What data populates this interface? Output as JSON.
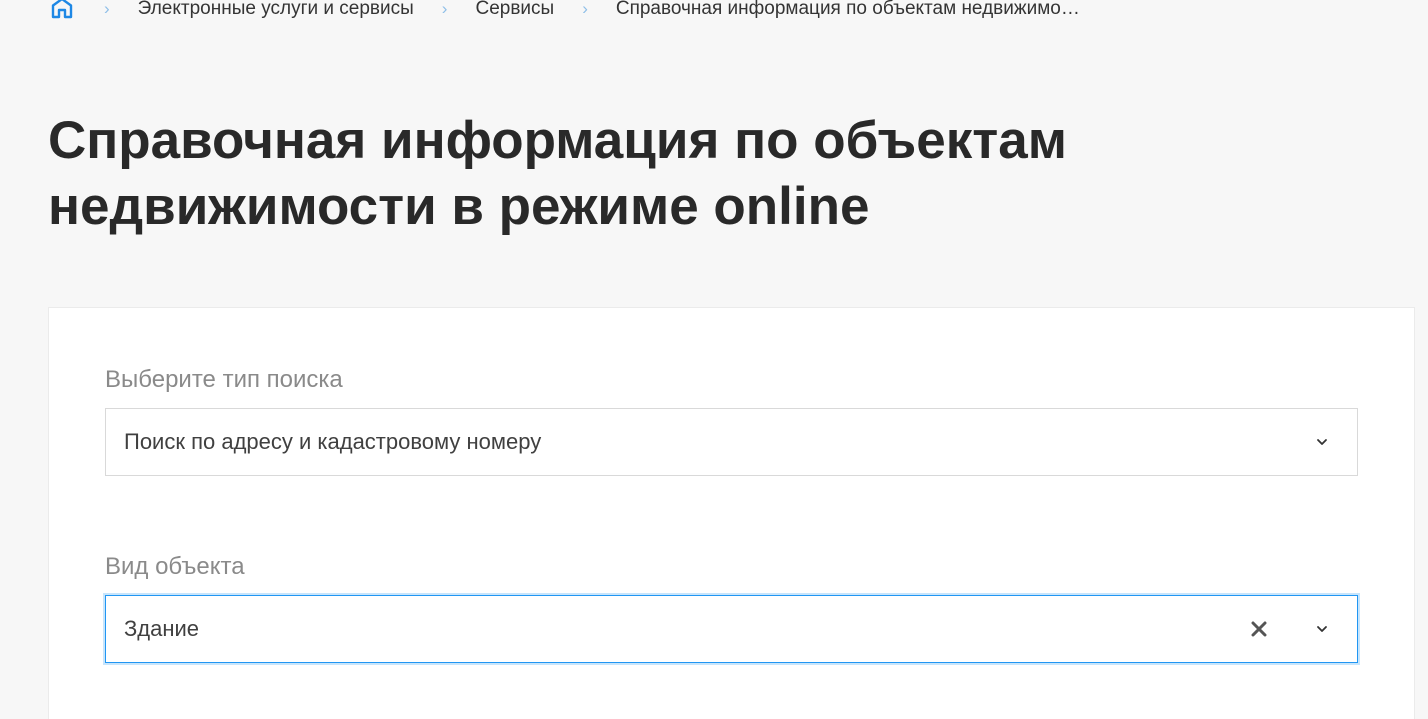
{
  "breadcrumb": {
    "home_icon": "home-icon",
    "separator": "›",
    "items": [
      {
        "label": "Электронные услуги и сервисы"
      },
      {
        "label": "Сервисы"
      },
      {
        "label": "Справочная информация по объектам недвижимо…"
      }
    ]
  },
  "page": {
    "title_line1": "Справочная информация по объектам",
    "title_line2": "недвижимости в режиме online"
  },
  "form": {
    "search_type": {
      "label": "Выберите тип поиска",
      "value": "Поиск по адресу и кадастровому номеру"
    },
    "object_type": {
      "label": "Вид объекта",
      "value": "Здание"
    }
  },
  "colors": {
    "accent": "#2196f3",
    "breadcrumb_separator": "#8fbfe8",
    "background": "#f7f7f7"
  }
}
